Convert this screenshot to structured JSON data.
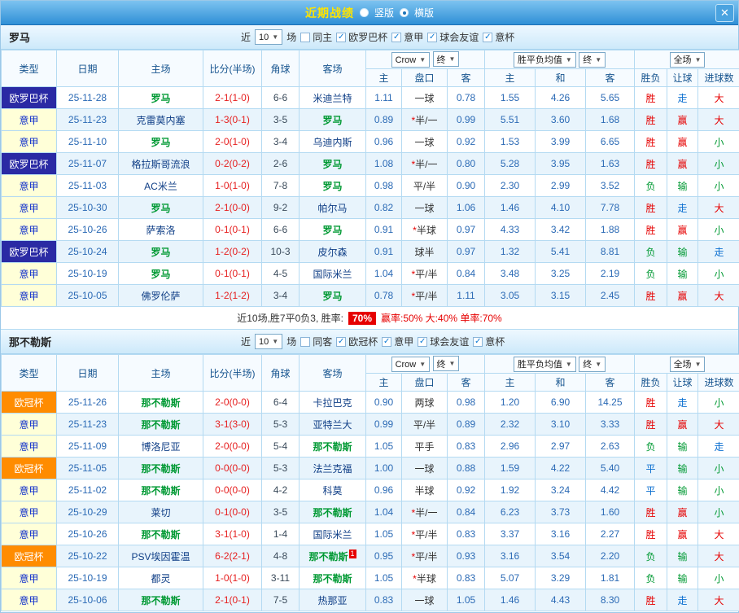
{
  "titlebar": {
    "title": "近期战绩",
    "vertical_label": "竖版",
    "horizontal_label": "横版",
    "close_icon": "✕"
  },
  "filters": {
    "near_label": "近",
    "count_value": "10",
    "unit_label": "场"
  },
  "table_header": {
    "type": "类型",
    "date": "日期",
    "home": "主场",
    "score": "比分(半场)",
    "corner": "角球",
    "away": "客场",
    "odds_source": "Crow",
    "final_label": "终",
    "avg_label": "胜平负均值",
    "final_label2": "终",
    "scope_label": "全场",
    "odds_home": "主",
    "odds_handicap": "盘口",
    "odds_away": "客",
    "avg_home": "主",
    "avg_draw": "和",
    "avg_away": "客",
    "result": "胜负",
    "handicap_result": "让球",
    "goals": "进球数",
    "dropdown_arrow": "▼"
  },
  "sections": [
    {
      "team": "罗马",
      "checkboxes": [
        {
          "label": "同主",
          "checked": false
        },
        {
          "label": "欧罗巴杯",
          "checked": true
        },
        {
          "label": "意甲",
          "checked": true
        },
        {
          "label": "球会友谊",
          "checked": true
        },
        {
          "label": "意杯",
          "checked": true
        }
      ],
      "rows": [
        {
          "type": "欧罗巴杯",
          "date": "25-11-28",
          "home": "罗马",
          "home_focal": true,
          "score": "2-1(1-0)",
          "corner": "6-6",
          "away": "米迪兰特",
          "odds": [
            "1.11",
            "一球",
            "0.78"
          ],
          "avg": [
            "1.55",
            "4.26",
            "5.65"
          ],
          "results": [
            "胜",
            "走",
            "大"
          ]
        },
        {
          "type": "意甲",
          "date": "25-11-23",
          "home": "克雷莫内塞",
          "score": "1-3(0-1)",
          "corner": "3-5",
          "away": "罗马",
          "away_focal": true,
          "odds": [
            "0.89",
            "*半/一",
            "0.99"
          ],
          "avg": [
            "5.51",
            "3.60",
            "1.68"
          ],
          "results": [
            "胜",
            "赢",
            "大"
          ]
        },
        {
          "type": "意甲",
          "date": "25-11-10",
          "home": "罗马",
          "home_focal": true,
          "score": "2-0(1-0)",
          "corner": "3-4",
          "away": "乌迪内斯",
          "odds": [
            "0.96",
            "一球",
            "0.92"
          ],
          "avg": [
            "1.53",
            "3.99",
            "6.65"
          ],
          "results": [
            "胜",
            "赢",
            "小"
          ]
        },
        {
          "type": "欧罗巴杯",
          "date": "25-11-07",
          "home": "格拉斯哥流浪",
          "score": "0-2(0-2)",
          "corner": "2-6",
          "away": "罗马",
          "away_focal": true,
          "odds": [
            "1.08",
            "*半/一",
            "0.80"
          ],
          "avg": [
            "5.28",
            "3.95",
            "1.63"
          ],
          "results": [
            "胜",
            "赢",
            "小"
          ]
        },
        {
          "type": "意甲",
          "date": "25-11-03",
          "home": "AC米兰",
          "score": "1-0(1-0)",
          "corner": "7-8",
          "away": "罗马",
          "away_focal": true,
          "odds": [
            "0.98",
            "平/半",
            "0.90"
          ],
          "avg": [
            "2.30",
            "2.99",
            "3.52"
          ],
          "results": [
            "负",
            "输",
            "小"
          ]
        },
        {
          "type": "意甲",
          "date": "25-10-30",
          "home": "罗马",
          "home_focal": true,
          "score": "2-1(0-0)",
          "corner": "9-2",
          "away": "帕尔马",
          "odds": [
            "0.82",
            "一球",
            "1.06"
          ],
          "avg": [
            "1.46",
            "4.10",
            "7.78"
          ],
          "results": [
            "胜",
            "走",
            "大"
          ]
        },
        {
          "type": "意甲",
          "date": "25-10-26",
          "home": "萨索洛",
          "score": "0-1(0-1)",
          "corner": "6-6",
          "away": "罗马",
          "away_focal": true,
          "odds": [
            "0.91",
            "*半球",
            "0.97"
          ],
          "avg": [
            "4.33",
            "3.42",
            "1.88"
          ],
          "results": [
            "胜",
            "赢",
            "小"
          ]
        },
        {
          "type": "欧罗巴杯",
          "date": "25-10-24",
          "home": "罗马",
          "home_focal": true,
          "score": "1-2(0-2)",
          "corner": "10-3",
          "away": "皮尔森",
          "odds": [
            "0.91",
            "球半",
            "0.97"
          ],
          "avg": [
            "1.32",
            "5.41",
            "8.81"
          ],
          "results": [
            "负",
            "输",
            "走"
          ]
        },
        {
          "type": "意甲",
          "date": "25-10-19",
          "home": "罗马",
          "home_focal": true,
          "score": "0-1(0-1)",
          "corner": "4-5",
          "away": "国际米兰",
          "odds": [
            "1.04",
            "*平/半",
            "0.84"
          ],
          "avg": [
            "3.48",
            "3.25",
            "2.19"
          ],
          "results": [
            "负",
            "输",
            "小"
          ]
        },
        {
          "type": "意甲",
          "date": "25-10-05",
          "home": "佛罗伦萨",
          "score": "1-2(1-2)",
          "corner": "3-4",
          "away": "罗马",
          "away_focal": true,
          "odds": [
            "0.78",
            "*平/半",
            "1.11"
          ],
          "avg": [
            "3.05",
            "3.15",
            "2.45"
          ],
          "results": [
            "胜",
            "赢",
            "大"
          ]
        }
      ],
      "summary": {
        "prefix": "近10场,胜7平0负3, 胜率:",
        "win_rate": "70%",
        "suffix": "赢率:50% 大:40% 单率:70%"
      }
    },
    {
      "team": "那不勒斯",
      "checkboxes": [
        {
          "label": "同客",
          "checked": false
        },
        {
          "label": "欧冠杯",
          "checked": true
        },
        {
          "label": "意甲",
          "checked": true
        },
        {
          "label": "球会友谊",
          "checked": true
        },
        {
          "label": "意杯",
          "checked": true
        }
      ],
      "rows": [
        {
          "type": "欧冠杯",
          "date": "25-11-26",
          "home": "那不勒斯",
          "home_focal": true,
          "score": "2-0(0-0)",
          "corner": "6-4",
          "away": "卡拉巴克",
          "odds": [
            "0.90",
            "两球",
            "0.98"
          ],
          "avg": [
            "1.20",
            "6.90",
            "14.25"
          ],
          "results": [
            "胜",
            "走",
            "小"
          ]
        },
        {
          "type": "意甲",
          "date": "25-11-23",
          "home": "那不勒斯",
          "home_focal": true,
          "score": "3-1(3-0)",
          "corner": "5-3",
          "away": "亚特兰大",
          "odds": [
            "0.99",
            "平/半",
            "0.89"
          ],
          "avg": [
            "2.32",
            "3.10",
            "3.33"
          ],
          "results": [
            "胜",
            "赢",
            "大"
          ]
        },
        {
          "type": "意甲",
          "date": "25-11-09",
          "home": "博洛尼亚",
          "score": "2-0(0-0)",
          "corner": "5-4",
          "away": "那不勒斯",
          "away_focal": true,
          "odds": [
            "1.05",
            "平手",
            "0.83"
          ],
          "avg": [
            "2.96",
            "2.97",
            "2.63"
          ],
          "results": [
            "负",
            "输",
            "走"
          ]
        },
        {
          "type": "欧冠杯",
          "date": "25-11-05",
          "home": "那不勒斯",
          "home_focal": true,
          "score": "0-0(0-0)",
          "corner": "5-3",
          "away": "法兰克福",
          "odds": [
            "1.00",
            "一球",
            "0.88"
          ],
          "avg": [
            "1.59",
            "4.22",
            "5.40"
          ],
          "results": [
            "平",
            "输",
            "小"
          ]
        },
        {
          "type": "意甲",
          "date": "25-11-02",
          "home": "那不勒斯",
          "home_focal": true,
          "score": "0-0(0-0)",
          "corner": "4-2",
          "away": "科莫",
          "odds": [
            "0.96",
            "半球",
            "0.92"
          ],
          "avg": [
            "1.92",
            "3.24",
            "4.42"
          ],
          "results": [
            "平",
            "输",
            "小"
          ]
        },
        {
          "type": "意甲",
          "date": "25-10-29",
          "home": "莱切",
          "score": "0-1(0-0)",
          "corner": "3-5",
          "away": "那不勒斯",
          "away_focal": true,
          "odds": [
            "1.04",
            "*半/一",
            "0.84"
          ],
          "avg": [
            "6.23",
            "3.73",
            "1.60"
          ],
          "results": [
            "胜",
            "赢",
            "小"
          ]
        },
        {
          "type": "意甲",
          "date": "25-10-26",
          "home": "那不勒斯",
          "home_focal": true,
          "score": "3-1(1-0)",
          "corner": "1-4",
          "away": "国际米兰",
          "odds": [
            "1.05",
            "*平/半",
            "0.83"
          ],
          "avg": [
            "3.37",
            "3.16",
            "2.27"
          ],
          "results": [
            "胜",
            "赢",
            "大"
          ]
        },
        {
          "type": "欧冠杯",
          "date": "25-10-22",
          "home": "PSV埃因霍温",
          "score": "6-2(2-1)",
          "corner": "4-8",
          "away": "那不勒斯",
          "away_focal": true,
          "away_badge": "1",
          "odds": [
            "0.95",
            "*平/半",
            "0.93"
          ],
          "avg": [
            "3.16",
            "3.54",
            "2.20"
          ],
          "results": [
            "负",
            "输",
            "大"
          ]
        },
        {
          "type": "意甲",
          "date": "25-10-19",
          "home": "都灵",
          "score": "1-0(1-0)",
          "corner": "3-11",
          "away": "那不勒斯",
          "away_focal": true,
          "odds": [
            "1.05",
            "*半球",
            "0.83"
          ],
          "avg": [
            "5.07",
            "3.29",
            "1.81"
          ],
          "results": [
            "负",
            "输",
            "小"
          ]
        },
        {
          "type": "意甲",
          "date": "25-10-06",
          "home": "那不勒斯",
          "home_focal": true,
          "score": "2-1(0-1)",
          "corner": "7-5",
          "away": "热那亚",
          "odds": [
            "0.83",
            "一球",
            "1.05"
          ],
          "avg": [
            "1.46",
            "4.43",
            "8.30"
          ],
          "results": [
            "胜",
            "走",
            "大"
          ]
        }
      ]
    }
  ]
}
